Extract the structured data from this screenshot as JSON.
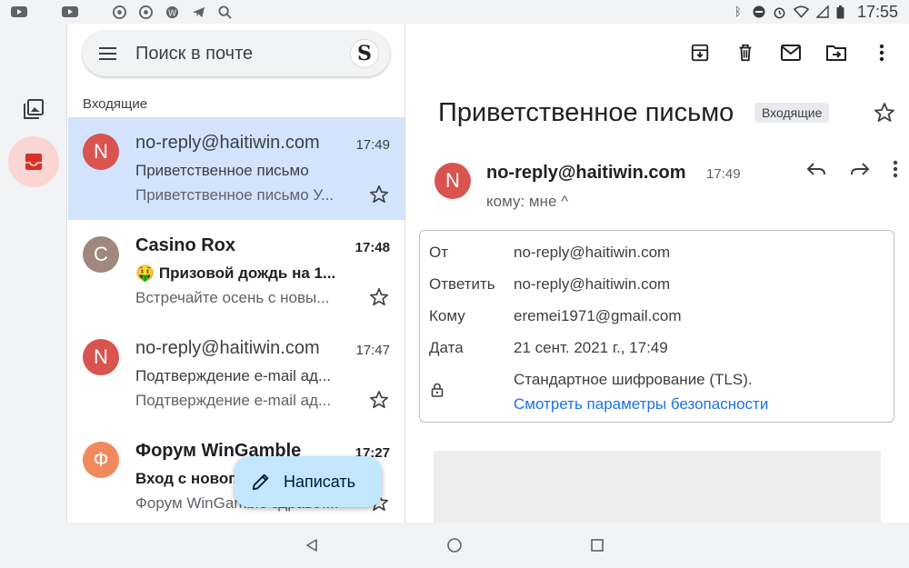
{
  "status_bar": {
    "time": "17:55"
  },
  "search": {
    "placeholder": "Поиск в почте",
    "avatar_letter": "S"
  },
  "inbox": {
    "section_label": "Входящие",
    "messages": [
      {
        "avatar": "N",
        "avatar_color": "#d9534f",
        "sender": "no-reply@haitiwin.com",
        "time": "17:49",
        "subject": "Приветственное письмо",
        "snippet": "Приветственное письмо У...",
        "unread": false,
        "selected": true
      },
      {
        "avatar": "C",
        "avatar_color": "#a1887f",
        "sender": "Casino Rox",
        "time": "17:48",
        "subject": "🤑 Призовой дождь на 1...",
        "snippet": "Встречайте осень с новы...",
        "unread": true,
        "selected": false
      },
      {
        "avatar": "N",
        "avatar_color": "#d9534f",
        "sender": "no-reply@haitiwin.com",
        "time": "17:47",
        "subject": "Подтверждение e-mail ад...",
        "snippet": "Подтверждение e-mail ад...",
        "unread": false,
        "selected": false
      },
      {
        "avatar": "Ф",
        "avatar_color": "#f08a5d",
        "sender": "Форум WinGamble",
        "time": "17:27",
        "subject": "Вход с новог...",
        "snippet": "Форум WinGamble здравст...",
        "unread": true,
        "selected": false
      }
    ]
  },
  "compose": {
    "label": "Написать"
  },
  "reader": {
    "subject": "Приветственное письмо",
    "label_chip": "Входящие",
    "from_avatar": "N",
    "from": "no-reply@haitiwin.com",
    "time": "17:49",
    "to_line": "кому: мне ^",
    "details": {
      "from_label": "От",
      "from_value": "no-reply@haitiwin.com",
      "reply_label": "Ответить",
      "reply_value": "no-reply@haitiwin.com",
      "to_label": "Кому",
      "to_value": "eremei1971@gmail.com",
      "date_label": "Дата",
      "date_value": "21 сент. 2021 г., 17:49",
      "encryption": "Стандартное шифрование (TLS).",
      "security_link": "Смотреть параметры безопасности"
    }
  },
  "colors": {
    "accent_blue": "#1a73e8",
    "selected_bg": "#d3e3fd",
    "fab_bg": "#c2e7ff",
    "rail_active": "#fbd5d3",
    "inbox_red": "#d93025"
  }
}
